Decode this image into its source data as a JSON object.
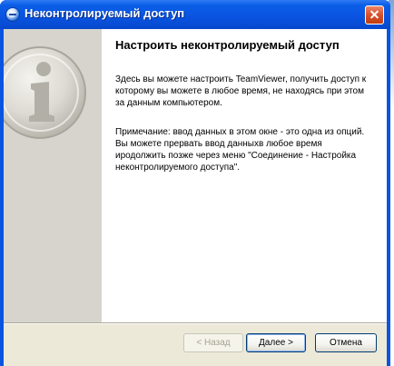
{
  "window": {
    "title": "Неконтролируемый доступ"
  },
  "main": {
    "heading": "Настроить неконтролируемый доступ",
    "paragraph1": "Здесь вы можете настроить TeamViewer, получить доступ к которому вы можете в любое время, не находясь при этом за данным компьютером.",
    "paragraph2": "Примечание: ввод данных в этом окне  - это одна из опций. Вы можете прервать ввод данныхв любое время иродолжить позже через меню \"Соединение - Настройка неконтролируемого доступа\"."
  },
  "buttons": {
    "back": "< Назад",
    "next": "Далее >",
    "cancel": "Отмена"
  },
  "icons": {
    "title": "teamviewer-icon",
    "info": "info-icon",
    "close": "close-icon"
  }
}
